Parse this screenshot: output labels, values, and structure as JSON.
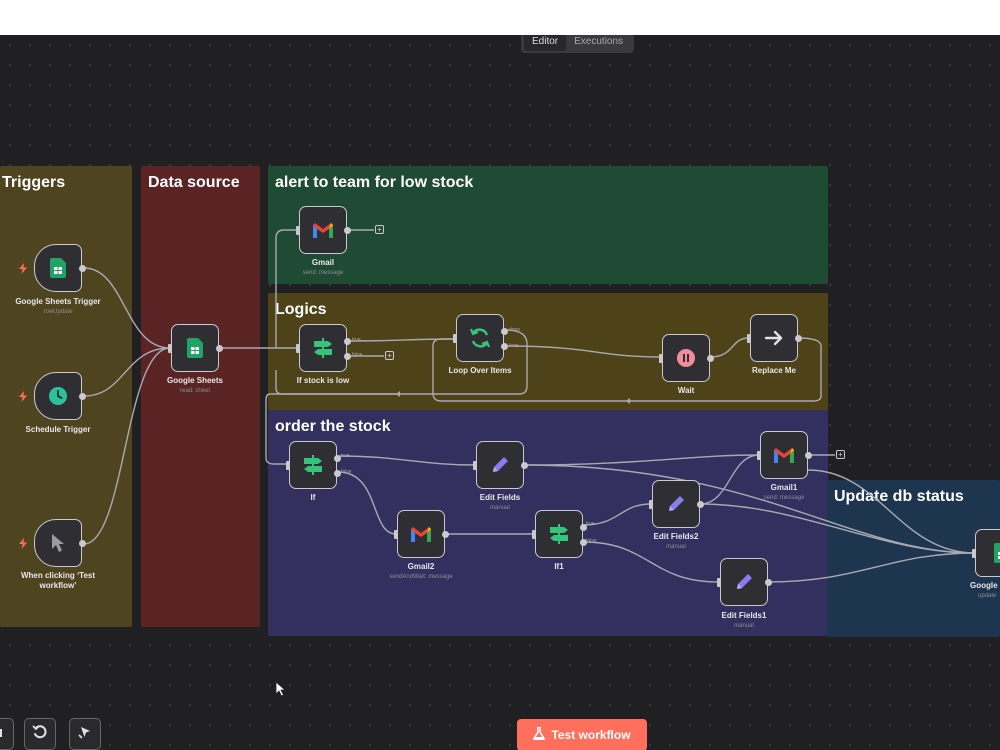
{
  "tabs": [
    "Editor",
    "Executions"
  ],
  "stickies": {
    "triggers": "Triggers",
    "data_source": "Data source",
    "alert": "alert to team for low stock",
    "logics": "Logics",
    "order": "order the stock",
    "update": "Update db status"
  },
  "nodes": {
    "sheets_trigger": {
      "label": "Google Sheets Trigger",
      "sub": "rowUpdate",
      "icon": "sheets-icon"
    },
    "schedule_trigger": {
      "label": "Schedule Trigger",
      "icon": "clock-icon"
    },
    "manual_trigger": {
      "label": "When clicking ‘Test",
      "label2": "workflow’",
      "icon": "cursor-icon"
    },
    "google_sheets": {
      "label": "Google Sheets",
      "sub": "read: sheet",
      "icon": "sheets-icon"
    },
    "gmail": {
      "label": "Gmail",
      "sub": "send: message",
      "icon": "gmail-icon"
    },
    "if_stock_low": {
      "label": "If stock is low",
      "icon": "if-icon"
    },
    "loop_over_items": {
      "label": "Loop Over Items",
      "icon": "loop-icon"
    },
    "wait": {
      "label": "Wait",
      "icon": "pause-icon"
    },
    "replace_me": {
      "label": "Replace Me",
      "icon": "arrow-right-icon"
    },
    "if": {
      "label": "If",
      "icon": "if-icon"
    },
    "edit_fields": {
      "label": "Edit Fields",
      "sub": "manual",
      "icon": "pencil-icon"
    },
    "gmail1": {
      "label": "Gmail1",
      "sub": "send: message",
      "icon": "gmail-icon"
    },
    "gmail2": {
      "label": "Gmail2",
      "sub": "sendAndWait: message",
      "icon": "gmail-icon"
    },
    "if1": {
      "label": "If1",
      "icon": "if-icon"
    },
    "edit_fields2": {
      "label": "Edit Fields2",
      "sub": "manual",
      "icon": "pencil-icon"
    },
    "edit_fields1": {
      "label": "Edit Fields1",
      "sub": "manual",
      "icon": "pencil-icon"
    },
    "google_sheets_update": {
      "label": "Google S",
      "sub": "update",
      "icon": "sheets-icon"
    }
  },
  "wire_labels": {
    "true": "true",
    "false": "false",
    "done": "done",
    "loop": "loop"
  },
  "toolbar": {
    "test_workflow": "Test workflow"
  },
  "colors": {
    "canvas": "#202022",
    "triggers": "#4f4420",
    "data_source": "#5a2424",
    "alert": "#1f4a33",
    "logics": "#4e4219",
    "order": "#332f5e",
    "update": "#1e3550",
    "accent": "#ff6f5c",
    "trigger_bolt": "#ff6d5a"
  }
}
